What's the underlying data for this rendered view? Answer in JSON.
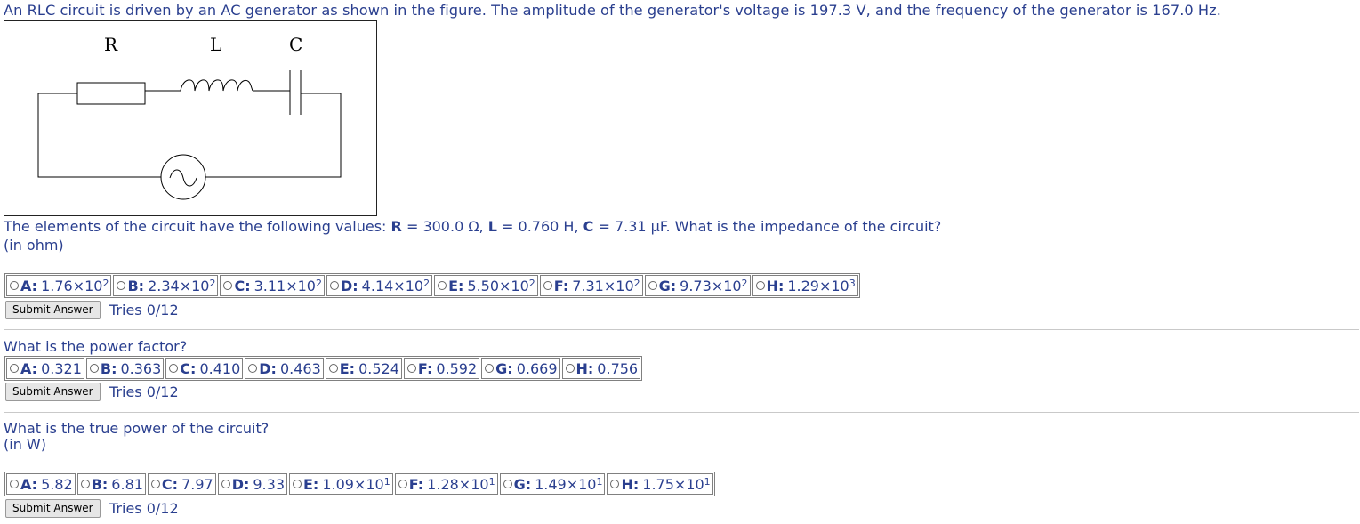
{
  "problem": {
    "intro": "An RLC circuit is driven by an AC generator as shown in the figure. The amplitude of the generator's voltage is 197.3 V, and the frequency of the generator is 167.0 Hz.",
    "figure_labels": {
      "r": "R",
      "l": "L",
      "c": "C"
    },
    "values_sentence": {
      "prefix": "The elements of the circuit have the following values: ",
      "r_name": "R",
      "r_value": " = 300.0 Ω, ",
      "l_name": "L",
      "l_value": " = 0.760 H, ",
      "c_name": "C",
      "c_value": " = 7.31 μF. What is the impedance of the circuit?"
    },
    "unit1": "(in ohm)"
  },
  "q1": {
    "choices": [
      {
        "letter": "A:",
        "mant": "1.76×10",
        "exp": "2"
      },
      {
        "letter": "B:",
        "mant": "2.34×10",
        "exp": "2"
      },
      {
        "letter": "C:",
        "mant": "3.11×10",
        "exp": "2"
      },
      {
        "letter": "D:",
        "mant": "4.14×10",
        "exp": "2"
      },
      {
        "letter": "E:",
        "mant": "5.50×10",
        "exp": "2"
      },
      {
        "letter": "F:",
        "mant": "7.31×10",
        "exp": "2"
      },
      {
        "letter": "G:",
        "mant": "9.73×10",
        "exp": "2"
      },
      {
        "letter": "H:",
        "mant": "1.29×10",
        "exp": "3"
      }
    ],
    "submit": "Submit Answer",
    "tries": "Tries 0/12"
  },
  "q2": {
    "question": "What is the power factor?",
    "choices": [
      {
        "letter": "A:",
        "mant": "0.321",
        "exp": ""
      },
      {
        "letter": "B:",
        "mant": "0.363",
        "exp": ""
      },
      {
        "letter": "C:",
        "mant": "0.410",
        "exp": ""
      },
      {
        "letter": "D:",
        "mant": "0.463",
        "exp": ""
      },
      {
        "letter": "E:",
        "mant": "0.524",
        "exp": ""
      },
      {
        "letter": "F:",
        "mant": "0.592",
        "exp": ""
      },
      {
        "letter": "G:",
        "mant": "0.669",
        "exp": ""
      },
      {
        "letter": "H:",
        "mant": "0.756",
        "exp": ""
      }
    ],
    "submit": "Submit Answer",
    "tries": "Tries 0/12"
  },
  "q3": {
    "question": "What is the true power of the circuit?",
    "unit": "(in W)",
    "choices": [
      {
        "letter": "A:",
        "mant": "5.82",
        "exp": ""
      },
      {
        "letter": "B:",
        "mant": "6.81",
        "exp": ""
      },
      {
        "letter": "C:",
        "mant": "7.97",
        "exp": ""
      },
      {
        "letter": "D:",
        "mant": "9.33",
        "exp": ""
      },
      {
        "letter": "E:",
        "mant": "1.09×10",
        "exp": "1"
      },
      {
        "letter": "F:",
        "mant": "1.28×10",
        "exp": "1"
      },
      {
        "letter": "G:",
        "mant": "1.49×10",
        "exp": "1"
      },
      {
        "letter": "H:",
        "mant": "1.75×10",
        "exp": "1"
      }
    ],
    "submit": "Submit Answer",
    "tries": "Tries 0/12"
  },
  "colors": {
    "text": "#2a3f8f",
    "border": "#808080",
    "button_bg": "#e6e6e6"
  }
}
